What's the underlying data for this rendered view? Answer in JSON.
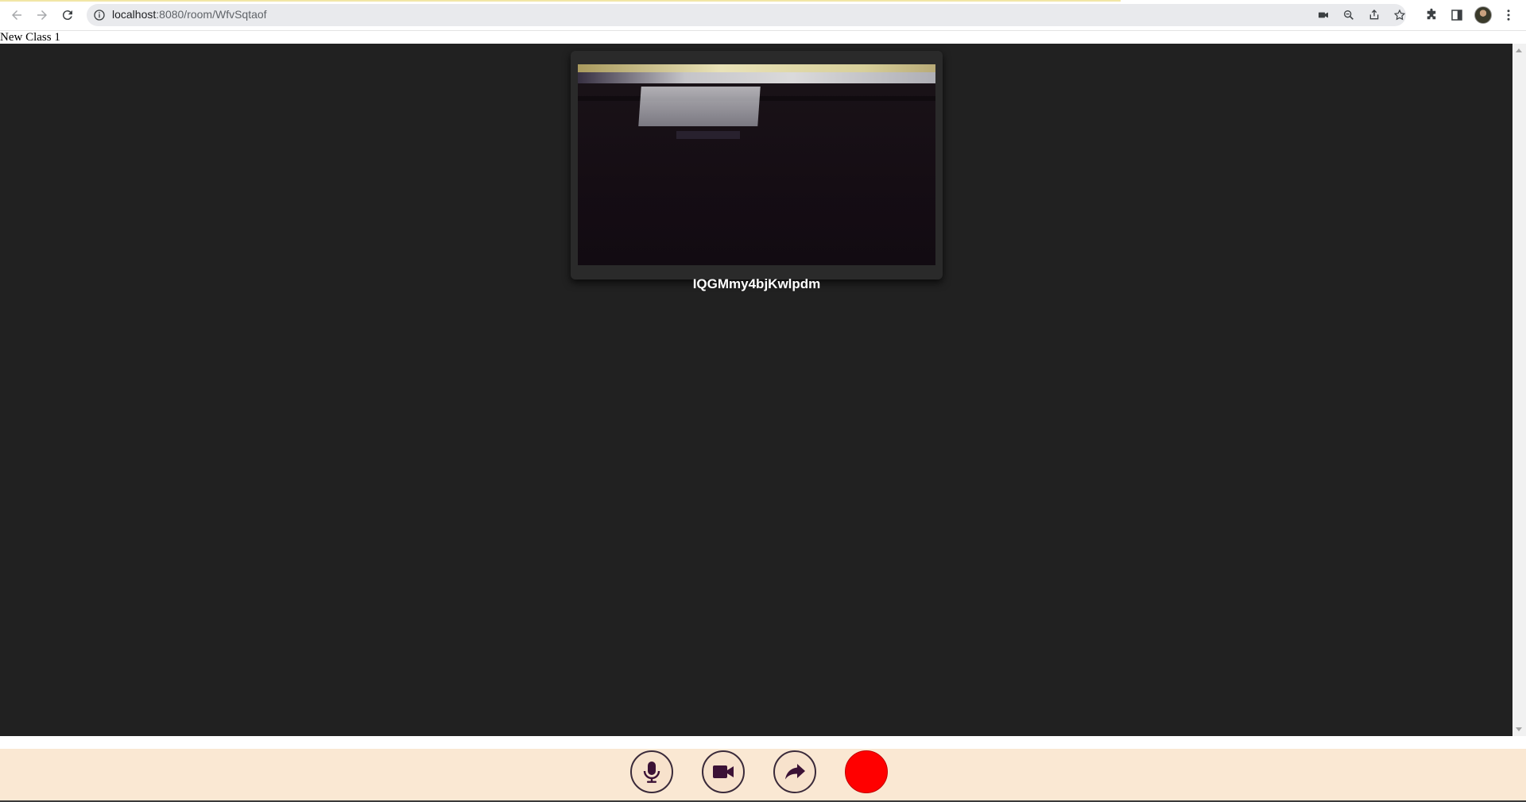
{
  "browser": {
    "url_host": "localhost",
    "url_rest": ":8080/room/WfvSqtaof",
    "toolbar": {
      "back_icon": "arrow-left-icon",
      "forward_icon": "arrow-right-icon",
      "reload_icon": "reload-icon",
      "info_icon": "info-icon",
      "camera_icon": "video-camera-icon",
      "zoom_icon": "zoom-icon",
      "share_icon": "share-icon",
      "bookmark_icon": "star-icon",
      "extensions_icon": "puzzle-icon",
      "sidepanel_icon": "side-panel-icon",
      "menu_icon": "kebab-menu-icon"
    }
  },
  "page": {
    "title": "New Class 1"
  },
  "video": {
    "participant_name": "IQGMmy4bjKwlpdm"
  },
  "controls": {
    "mic_icon": "microphone-icon",
    "camera_icon": "video-camera-icon",
    "share_icon": "share-arrow-icon",
    "record_icon": "record-icon",
    "icon_color": "#3b1236",
    "record_color": "#ff0000",
    "bar_color": "#fae8d3"
  },
  "colors": {
    "stage": "#212121"
  }
}
